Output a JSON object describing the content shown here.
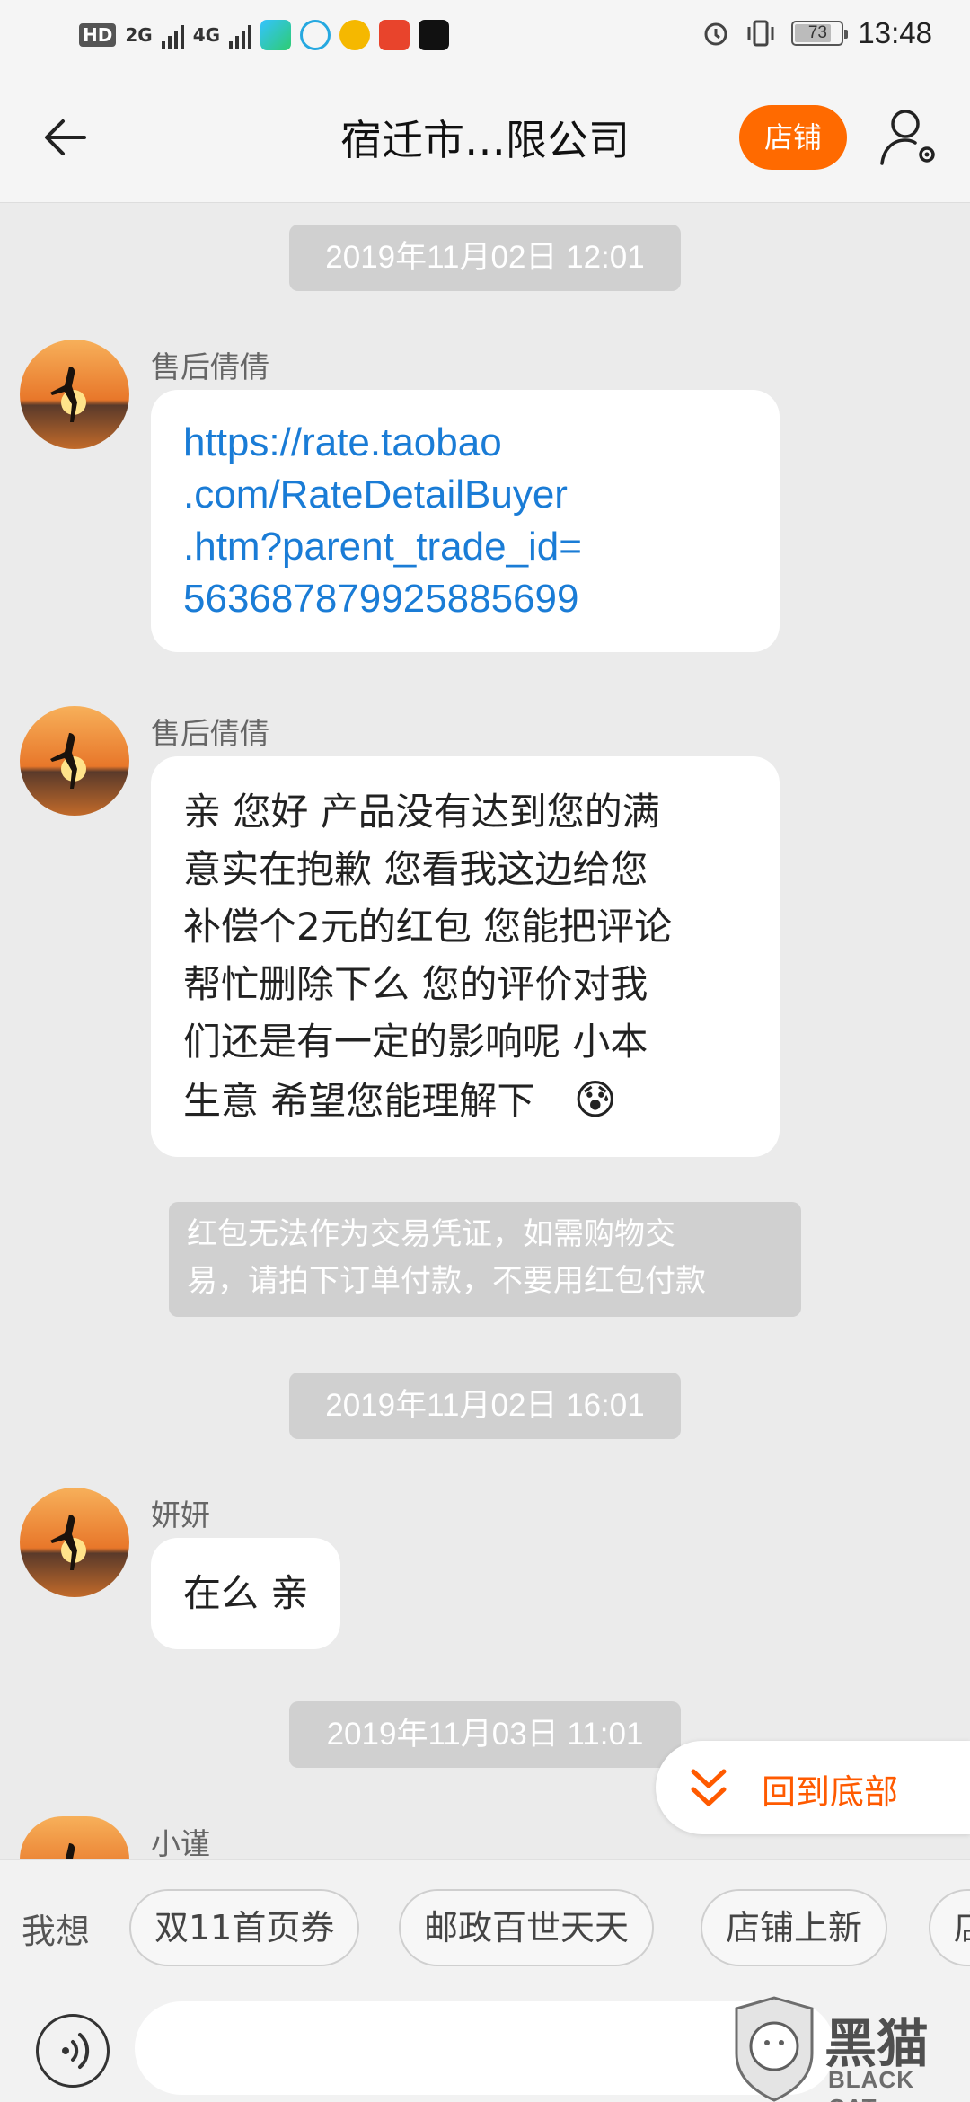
{
  "status_bar": {
    "tags": [
      "HD",
      "2G",
      "4G"
    ],
    "battery": "73",
    "time": "13:48"
  },
  "header": {
    "title": "宿迁市…限公司",
    "shop_label": "店铺"
  },
  "messages": [
    {
      "type": "time",
      "text": "2019年11月02日 12:01"
    },
    {
      "type": "msg",
      "sender": "售后倩倩",
      "lines": [
        "https://rate.taobao",
        ".com/RateDetailBuyer",
        ".htm?parent_trade_id=",
        "563687879925885699"
      ]
    },
    {
      "type": "msg",
      "sender": "售后倩倩",
      "lines": [
        "亲 您好 产品没有达到您的满",
        "意实在抱歉 您看我这边给您",
        "补偿个2元的红包 您能把评论",
        "帮忙删除下么 您的评价对我",
        "们还是有一定的影响呢 小本",
        "生意 希望您能理解下"
      ],
      "emoji": "😰"
    },
    {
      "type": "notice",
      "lines": [
        "红包无法作为交易凭证，如需购物交",
        "易，请拍下订单付款，不要用红包付款"
      ]
    },
    {
      "type": "time",
      "text": "2019年11月02日 16:01"
    },
    {
      "type": "msg",
      "sender": "妍妍",
      "lines": [
        "在么 亲"
      ]
    },
    {
      "type": "time",
      "text": "2019年11月03日 11:01"
    },
    {
      "type": "msg",
      "sender": "小谨",
      "lines": []
    }
  ],
  "back_to_bottom": "回到底部",
  "quick_bar": {
    "prefix": "我想",
    "chips": [
      "双11首页券",
      "邮政百世天天",
      "店铺上新",
      "店"
    ]
  },
  "input": {
    "placeholder": ""
  },
  "watermark": {
    "big": "黑猫",
    "text": "BLACK CAT"
  },
  "colors": {
    "accent": "#ff6a00",
    "link": "#1a7cd6",
    "background": "#ebebeb"
  }
}
